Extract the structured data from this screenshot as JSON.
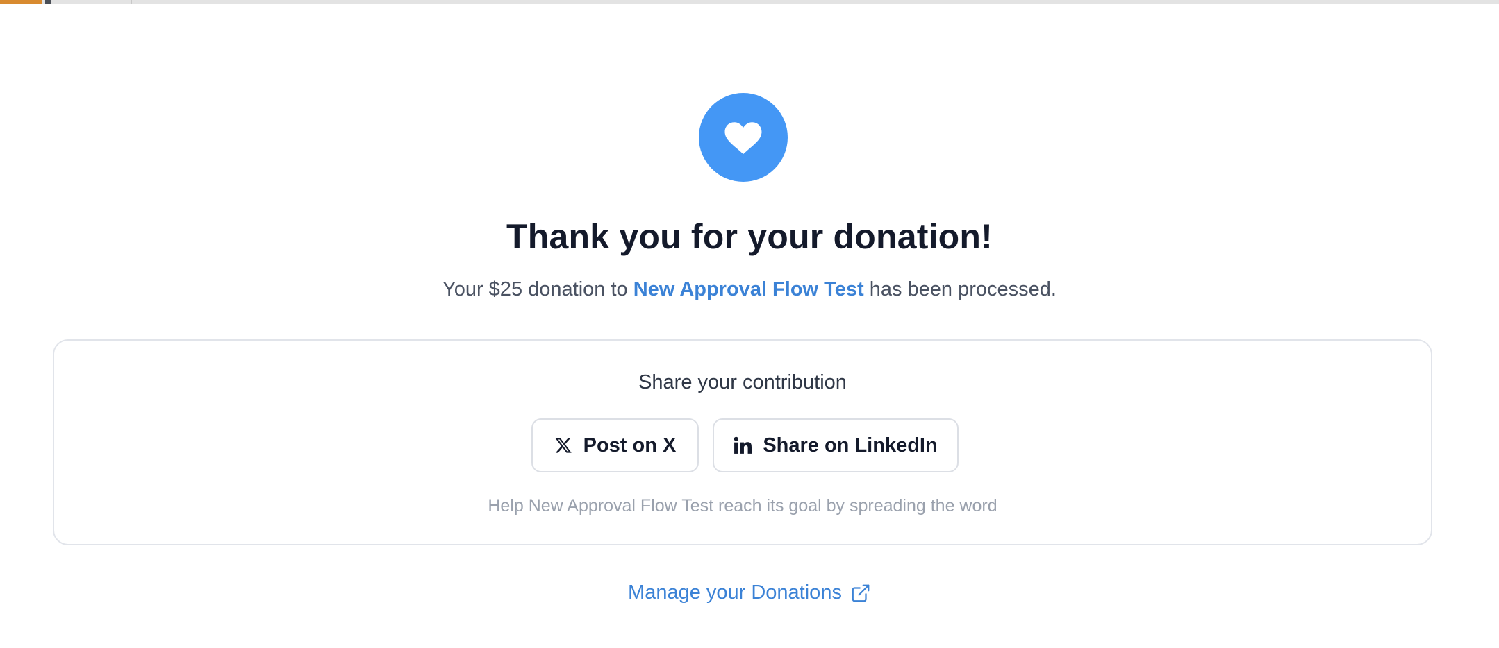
{
  "top_strip": {
    "accent_color": "#d88a2f",
    "track_color": "#e3e3e3"
  },
  "hero": {
    "icon": "heart-icon",
    "icon_bg_color": "#4497f5",
    "title": "Thank you for your donation!",
    "subtitle_prefix": "Your $25 donation to ",
    "campaign_name": "New Approval Flow Test",
    "subtitle_suffix": " has been processed."
  },
  "share": {
    "heading": "Share your contribution",
    "buttons": [
      {
        "label": "Post on X",
        "icon": "x-logo-icon"
      },
      {
        "label": "Share on LinkedIn",
        "icon": "linkedin-icon"
      }
    ],
    "help_text": "Help New Approval Flow Test reach its goal by spreading the word"
  },
  "footer": {
    "manage_label": "Manage your Donations",
    "manage_icon": "external-link-icon",
    "link_color": "#3b82d6"
  }
}
